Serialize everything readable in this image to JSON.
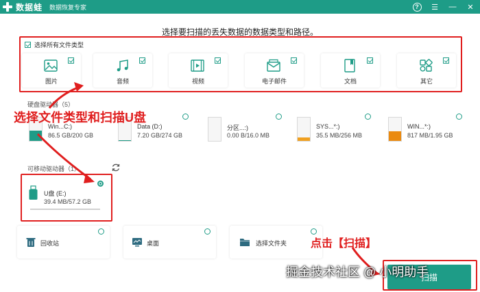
{
  "app": {
    "name": "数据蛙",
    "subtitle": "数据恢复专家",
    "help_glyph": "?"
  },
  "window_controls": {
    "menu": "☰",
    "minimize": "—",
    "close": "✕"
  },
  "heading": "选择要扫描的丢失数据的数据类型和路径。",
  "file_types": {
    "select_all_label": "选择所有文件类型",
    "items": [
      {
        "label": "图片",
        "icon": "image-icon",
        "checked": true
      },
      {
        "label": "音频",
        "icon": "music-icon",
        "checked": true
      },
      {
        "label": "视频",
        "icon": "video-icon",
        "checked": true
      },
      {
        "label": "电子邮件",
        "icon": "email-icon",
        "checked": true
      },
      {
        "label": "文档",
        "icon": "document-icon",
        "checked": true
      },
      {
        "label": "其它",
        "icon": "other-icon",
        "checked": true
      }
    ]
  },
  "hard_drives": {
    "label": "硬盘驱动器（5）",
    "items": [
      {
        "name": "Win...C:)",
        "size": "86.5 GB/200 GB",
        "fill": 0.43,
        "color": "#1e9c87"
      },
      {
        "name": "Data (D:)",
        "size": "7.20 GB/274 GB",
        "fill": 0.03,
        "color": "#1e9c87"
      },
      {
        "name": "分区...:)",
        "size": "0.00  B/16.0 MB",
        "fill": 0.0,
        "color": "#1e9c87"
      },
      {
        "name": "SYS...*:)",
        "size": "35.5 MB/256 MB",
        "fill": 0.14,
        "color": "#f0a020"
      },
      {
        "name": "WIN...*:)",
        "size": "817 MB/1.95 GB",
        "fill": 0.42,
        "color": "#ea8a10"
      }
    ]
  },
  "removable": {
    "label": "可移动驱动器（1）",
    "items": [
      {
        "name": "U盘 (E:)",
        "size": "39.4 MB/57.2 GB",
        "selected": true
      }
    ]
  },
  "locations": [
    {
      "label": "回收站",
      "icon": "recycle-bin-icon"
    },
    {
      "label": "桌面",
      "icon": "desktop-icon"
    },
    {
      "label": "选择文件夹",
      "icon": "folder-icon"
    }
  ],
  "annotations": {
    "select_types": "选择文件类型和扫描U盘",
    "click_scan": "点击【扫描】"
  },
  "scan_button": "扫描",
  "watermark": "掘金技术社区 @ 小明助手",
  "colors": {
    "accent": "#1e9c87",
    "annotation": "#e01e1e"
  }
}
